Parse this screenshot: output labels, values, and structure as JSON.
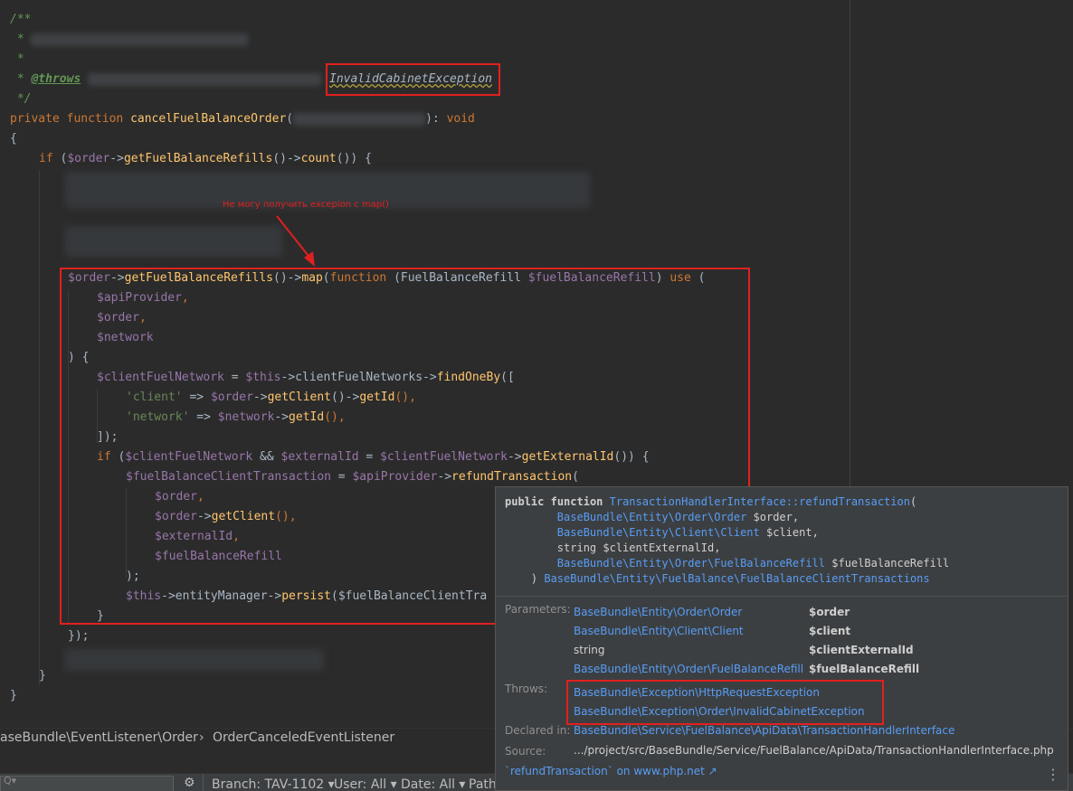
{
  "colors": {
    "background": "#2b2b2b",
    "keyword": "#cc7832",
    "function": "#ffc66d",
    "variable": "#9876aa",
    "string": "#6a8759",
    "comment": "#629755",
    "highlight_box": "#e0201f",
    "link": "#589df6"
  },
  "code": {
    "doc_open": "/**",
    "doc_star": " *",
    "doc_throws_tag": "@throws",
    "doc_throws_exception": "InvalidCabinetException",
    "doc_close": " */",
    "l_private": "private",
    "l_function": "function",
    "l_method": "cancelFuelBalanceOrder",
    "l_paren_open": "(",
    "l_paren_close": "): ",
    "l_void": "void",
    "l_brace_open": "{",
    "if1_kw": "if",
    "if1_open": " (",
    "if1_order": "$order",
    "if1_arrow": "->",
    "if1_call": "getFuelBalanceRefills",
    "if1_mid": "()->",
    "if1_count": "count",
    "if1_close": "()) {",
    "map_order": "$order",
    "map_arrow1": "->",
    "map_get": "getFuelBalanceRefills",
    "map_arrow2": "()->",
    "map_fn": "map",
    "map_paren": "(",
    "map_function": "function",
    "map_param_open": " (FuelBalanceRefill ",
    "map_param_var": "$fuelBalanceRefill",
    "map_param_close": ") ",
    "map_use": "use",
    "map_use_paren": " (",
    "use_api": "$apiProvider",
    "use_order": "$order",
    "use_network": "$network",
    "comma": ",",
    "use_close": ") {",
    "cfn_var": "$clientFuelNetwork",
    "cfn_eq": " = ",
    "cfn_this": "$this",
    "cfn_prop": "->clientFuelNetworks->",
    "cfn_find": "findOneBy",
    "cfn_bracket": "([",
    "arr_client_key": "'client'",
    "arr_arrow": " => ",
    "arr_order": "$order",
    "arr_getclient_arrow": "->",
    "arr_getclient": "getClient",
    "arr_getid_arrow": "()->",
    "arr_getid": "getId",
    "arr_end": "(),",
    "arr_network_key": "'network'",
    "arr_network_var": "$network",
    "arr_close": "]);",
    "if2_kw": "if",
    "if2_open": " (",
    "if2_cfn": "$clientFuelNetwork",
    "if2_and": " && ",
    "if2_ext": "$externalId",
    "if2_eq": " = ",
    "if2_cfn2": "$clientFuelNetwork",
    "if2_arrow": "->",
    "if2_get": "getExternalId",
    "if2_close": "()) {",
    "fbct_var": "$fuelBalanceClientTransaction",
    "fbct_eq": " = ",
    "fbct_api": "$apiProvider",
    "fbct_arrow": "->",
    "fbct_refund": "refundTransaction",
    "fbct_paren": "(",
    "arg_order": "$order",
    "arg_order2": "$order",
    "arg_getclient": "getClient",
    "arg_ext": "$externalId",
    "arg_refill": "$fuelBalanceRefill",
    "call_close": ");",
    "persist_this": "$this",
    "persist_em": "->entityManager->",
    "persist_fn": "persist",
    "persist_var": "($fuelBalanceClientTra",
    "brace_close": "}",
    "map_end": "});",
    "paren_close_semicolon": ");"
  },
  "annotation": {
    "text": "Не могу получить excepion с map()"
  },
  "breadcrumb": {
    "namespace": "aseBundle\\EventListener\\Order",
    "separator": "›",
    "class_name": "OrderCanceledEventListener"
  },
  "statusbar": {
    "search_placeholder": "Q▾",
    "settings_icon": "⚙",
    "branch": "Branch: TAV-1102 ▾",
    "user": "User: All ▾",
    "date": "Date: All ▾",
    "path": "Path"
  },
  "popup": {
    "sig_public": "public",
    "sig_function": "function",
    "sig_method": "TransactionHandlerInterface::refundTransaction",
    "sig_paren": "(",
    "sig_p1_type": "BaseBundle\\Entity\\Order\\Order",
    "sig_p1_var": " $order,",
    "sig_p2_type": "BaseBundle\\Entity\\Client\\Client",
    "sig_p2_var": " $client,",
    "sig_p3": "string $clientExternalId,",
    "sig_p4_type": "BaseBundle\\Entity\\Order\\FuelBalanceRefill",
    "sig_p4_var": " $fuelBalanceRefill",
    "sig_close": ") ",
    "sig_return": "BaseBundle\\Entity\\FuelBalance\\FuelBalanceClientTransactions",
    "params_label": "Parameters:",
    "params": [
      {
        "type": "BaseBundle\\Entity\\Order\\Order",
        "name": "$order"
      },
      {
        "type": "BaseBundle\\Entity\\Client\\Client",
        "name": "$client"
      },
      {
        "type": "string",
        "name": "$clientExternalId"
      },
      {
        "type": "BaseBundle\\Entity\\Order\\FuelBalanceRefill",
        "name": "$fuelBalanceRefill"
      }
    ],
    "throws_label": "Throws:",
    "throws": [
      "BaseBundle\\Exception\\HttpRequestException",
      "BaseBundle\\Exception\\Order\\InvalidCabinetException"
    ],
    "declared_label": "Declared in:",
    "declared_value": "BaseBundle\\Service\\FuelBalance\\ApiData\\TransactionHandlerInterface",
    "source_label": "Source:",
    "source_value": ".../project/src/BaseBundle/Service/FuelBalance/ApiData/TransactionHandlerInterface.php",
    "php_net": "`refundTransaction` on www.php.net ↗",
    "more_icon": "⋮"
  }
}
